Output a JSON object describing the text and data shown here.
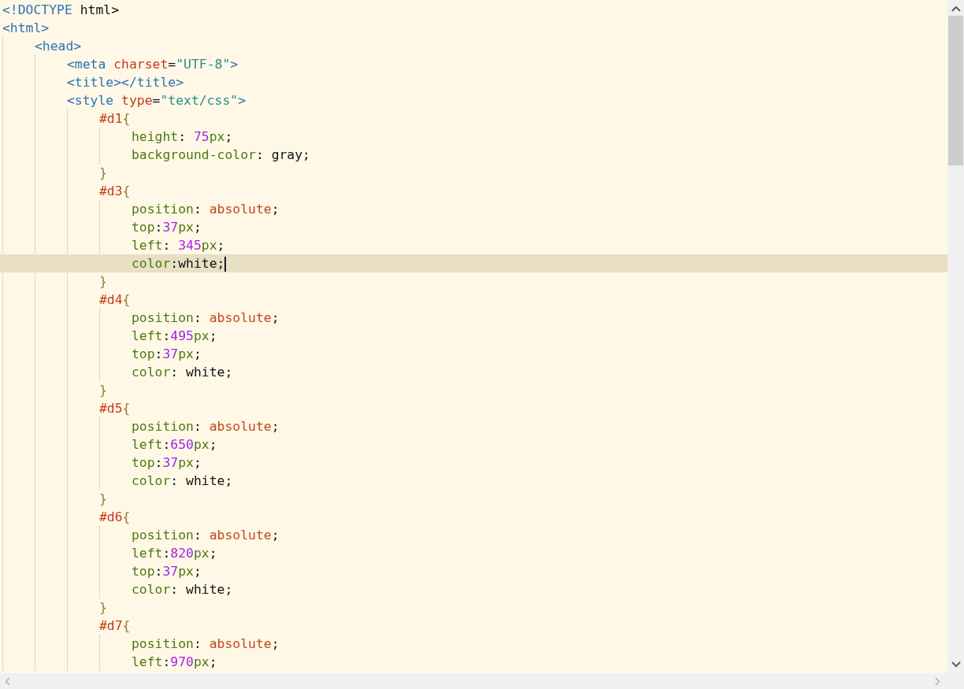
{
  "editor": {
    "lines": [
      {
        "tokens": [
          {
            "kind": "tag",
            "text": "<!DOCTYPE"
          },
          {
            "kind": "plain",
            "text": " html>"
          }
        ]
      },
      {
        "tokens": [
          {
            "kind": "tag",
            "text": "<html>"
          }
        ],
        "children": [
          {
            "tokens": [
              {
                "kind": "tag",
                "text": "<head>"
              }
            ],
            "children": [
              {
                "tokens": [
                  {
                    "kind": "tag",
                    "text": "<meta "
                  },
                  {
                    "kind": "attr",
                    "text": "charset"
                  },
                  {
                    "kind": "plain",
                    "text": "="
                  },
                  {
                    "kind": "str",
                    "text": "\"UTF-8\""
                  },
                  {
                    "kind": "tag",
                    "text": ">"
                  }
                ]
              },
              {
                "tokens": [
                  {
                    "kind": "tag",
                    "text": "<title></title>"
                  }
                ]
              },
              {
                "tokens": [
                  {
                    "kind": "tag",
                    "text": "<style "
                  },
                  {
                    "kind": "attr",
                    "text": "type"
                  },
                  {
                    "kind": "plain",
                    "text": "="
                  },
                  {
                    "kind": "str",
                    "text": "\"text/css\""
                  },
                  {
                    "kind": "tag",
                    "text": ">"
                  }
                ],
                "children": [
                  {
                    "tokens": [
                      {
                        "kind": "sel",
                        "text": "#d1"
                      },
                      {
                        "kind": "brace",
                        "text": "{"
                      }
                    ],
                    "children": [
                      {
                        "tokens": [
                          {
                            "kind": "prop",
                            "text": "height"
                          },
                          {
                            "kind": "plain",
                            "text": ": "
                          },
                          {
                            "kind": "num",
                            "text": "75"
                          },
                          {
                            "kind": "prop",
                            "text": "px"
                          },
                          {
                            "kind": "plain",
                            "text": ";"
                          }
                        ]
                      },
                      {
                        "tokens": [
                          {
                            "kind": "prop",
                            "text": "background-color"
                          },
                          {
                            "kind": "plain",
                            "text": ": gray;"
                          }
                        ]
                      }
                    ]
                  },
                  {
                    "tokens": [
                      {
                        "kind": "brace",
                        "text": "}"
                      }
                    ]
                  },
                  {
                    "tokens": [
                      {
                        "kind": "sel",
                        "text": "#d3"
                      },
                      {
                        "kind": "brace",
                        "text": "{"
                      }
                    ],
                    "children": [
                      {
                        "tokens": [
                          {
                            "kind": "prop",
                            "text": "position"
                          },
                          {
                            "kind": "plain",
                            "text": ": "
                          },
                          {
                            "kind": "kw",
                            "text": "absolute"
                          },
                          {
                            "kind": "plain",
                            "text": ";"
                          }
                        ]
                      },
                      {
                        "tokens": [
                          {
                            "kind": "prop",
                            "text": "top"
                          },
                          {
                            "kind": "plain",
                            "text": ":"
                          },
                          {
                            "kind": "num",
                            "text": "37"
                          },
                          {
                            "kind": "prop",
                            "text": "px"
                          },
                          {
                            "kind": "plain",
                            "text": ";"
                          }
                        ]
                      },
                      {
                        "tokens": [
                          {
                            "kind": "prop",
                            "text": "left"
                          },
                          {
                            "kind": "plain",
                            "text": ": "
                          },
                          {
                            "kind": "num",
                            "text": "345"
                          },
                          {
                            "kind": "prop",
                            "text": "px"
                          },
                          {
                            "kind": "plain",
                            "text": ";"
                          }
                        ]
                      },
                      {
                        "current": true,
                        "tokens": [
                          {
                            "kind": "prop",
                            "text": "color"
                          },
                          {
                            "kind": "plain",
                            "text": ":white;"
                          }
                        ]
                      }
                    ]
                  },
                  {
                    "tokens": [
                      {
                        "kind": "brace",
                        "text": "}"
                      }
                    ]
                  },
                  {
                    "tokens": [
                      {
                        "kind": "sel",
                        "text": "#d4"
                      },
                      {
                        "kind": "brace",
                        "text": "{"
                      }
                    ],
                    "children": [
                      {
                        "tokens": [
                          {
                            "kind": "prop",
                            "text": "position"
                          },
                          {
                            "kind": "plain",
                            "text": ": "
                          },
                          {
                            "kind": "kw",
                            "text": "absolute"
                          },
                          {
                            "kind": "plain",
                            "text": ";"
                          }
                        ]
                      },
                      {
                        "tokens": [
                          {
                            "kind": "prop",
                            "text": "left"
                          },
                          {
                            "kind": "plain",
                            "text": ":"
                          },
                          {
                            "kind": "num",
                            "text": "495"
                          },
                          {
                            "kind": "prop",
                            "text": "px"
                          },
                          {
                            "kind": "plain",
                            "text": ";"
                          }
                        ]
                      },
                      {
                        "tokens": [
                          {
                            "kind": "prop",
                            "text": "top"
                          },
                          {
                            "kind": "plain",
                            "text": ":"
                          },
                          {
                            "kind": "num",
                            "text": "37"
                          },
                          {
                            "kind": "prop",
                            "text": "px"
                          },
                          {
                            "kind": "plain",
                            "text": ";"
                          }
                        ]
                      },
                      {
                        "tokens": [
                          {
                            "kind": "prop",
                            "text": "color"
                          },
                          {
                            "kind": "plain",
                            "text": ": white;"
                          }
                        ]
                      }
                    ]
                  },
                  {
                    "tokens": [
                      {
                        "kind": "brace",
                        "text": "}"
                      }
                    ]
                  },
                  {
                    "tokens": [
                      {
                        "kind": "sel",
                        "text": "#d5"
                      },
                      {
                        "kind": "brace",
                        "text": "{"
                      }
                    ],
                    "children": [
                      {
                        "tokens": [
                          {
                            "kind": "prop",
                            "text": "position"
                          },
                          {
                            "kind": "plain",
                            "text": ": "
                          },
                          {
                            "kind": "kw",
                            "text": "absolute"
                          },
                          {
                            "kind": "plain",
                            "text": ";"
                          }
                        ]
                      },
                      {
                        "tokens": [
                          {
                            "kind": "prop",
                            "text": "left"
                          },
                          {
                            "kind": "plain",
                            "text": ":"
                          },
                          {
                            "kind": "num",
                            "text": "650"
                          },
                          {
                            "kind": "prop",
                            "text": "px"
                          },
                          {
                            "kind": "plain",
                            "text": ";"
                          }
                        ]
                      },
                      {
                        "tokens": [
                          {
                            "kind": "prop",
                            "text": "top"
                          },
                          {
                            "kind": "plain",
                            "text": ":"
                          },
                          {
                            "kind": "num",
                            "text": "37"
                          },
                          {
                            "kind": "prop",
                            "text": "px"
                          },
                          {
                            "kind": "plain",
                            "text": ";"
                          }
                        ]
                      },
                      {
                        "tokens": [
                          {
                            "kind": "prop",
                            "text": "color"
                          },
                          {
                            "kind": "plain",
                            "text": ": white;"
                          }
                        ]
                      }
                    ]
                  },
                  {
                    "tokens": [
                      {
                        "kind": "brace",
                        "text": "}"
                      }
                    ]
                  },
                  {
                    "tokens": [
                      {
                        "kind": "sel",
                        "text": "#d6"
                      },
                      {
                        "kind": "brace",
                        "text": "{"
                      }
                    ],
                    "children": [
                      {
                        "tokens": [
                          {
                            "kind": "prop",
                            "text": "position"
                          },
                          {
                            "kind": "plain",
                            "text": ": "
                          },
                          {
                            "kind": "kw",
                            "text": "absolute"
                          },
                          {
                            "kind": "plain",
                            "text": ";"
                          }
                        ]
                      },
                      {
                        "tokens": [
                          {
                            "kind": "prop",
                            "text": "left"
                          },
                          {
                            "kind": "plain",
                            "text": ":"
                          },
                          {
                            "kind": "num",
                            "text": "820"
                          },
                          {
                            "kind": "prop",
                            "text": "px"
                          },
                          {
                            "kind": "plain",
                            "text": ";"
                          }
                        ]
                      },
                      {
                        "tokens": [
                          {
                            "kind": "prop",
                            "text": "top"
                          },
                          {
                            "kind": "plain",
                            "text": ":"
                          },
                          {
                            "kind": "num",
                            "text": "37"
                          },
                          {
                            "kind": "prop",
                            "text": "px"
                          },
                          {
                            "kind": "plain",
                            "text": ";"
                          }
                        ]
                      },
                      {
                        "tokens": [
                          {
                            "kind": "prop",
                            "text": "color"
                          },
                          {
                            "kind": "plain",
                            "text": ": white;"
                          }
                        ]
                      }
                    ]
                  },
                  {
                    "tokens": [
                      {
                        "kind": "brace",
                        "text": "}"
                      }
                    ]
                  },
                  {
                    "tokens": [
                      {
                        "kind": "sel",
                        "text": "#d7"
                      },
                      {
                        "kind": "brace",
                        "text": "{"
                      }
                    ],
                    "children": [
                      {
                        "tokens": [
                          {
                            "kind": "prop",
                            "text": "position"
                          },
                          {
                            "kind": "plain",
                            "text": ": "
                          },
                          {
                            "kind": "kw",
                            "text": "absolute"
                          },
                          {
                            "kind": "plain",
                            "text": ";"
                          }
                        ]
                      },
                      {
                        "tokens": [
                          {
                            "kind": "prop",
                            "text": "left"
                          },
                          {
                            "kind": "plain",
                            "text": ":"
                          },
                          {
                            "kind": "num",
                            "text": "970"
                          },
                          {
                            "kind": "prop",
                            "text": "px"
                          },
                          {
                            "kind": "plain",
                            "text": ";"
                          }
                        ]
                      }
                    ]
                  }
                ]
              }
            ]
          }
        ]
      }
    ]
  }
}
